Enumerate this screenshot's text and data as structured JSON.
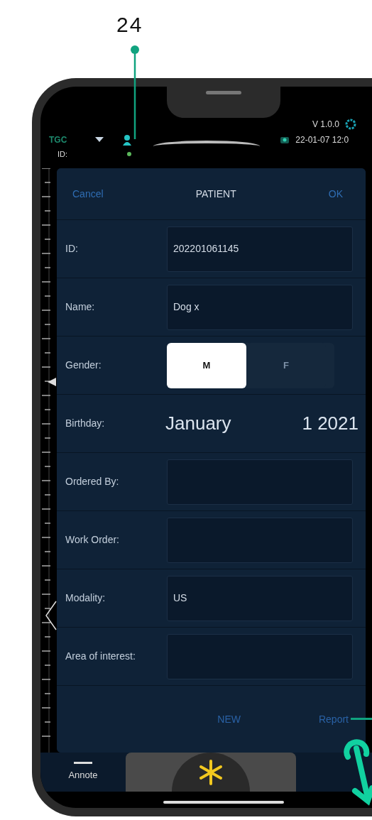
{
  "callout": {
    "number": "24"
  },
  "status_bar": {
    "mode": "TGC",
    "version": "V 1.0.0",
    "datetime": "22-01-07 12:0",
    "id_label": "ID:"
  },
  "dialog": {
    "cancel": "Cancel",
    "title": "PATIENT",
    "ok": "OK",
    "fields": [
      {
        "kind": "input",
        "label": "ID:",
        "value": "202201061145"
      },
      {
        "kind": "input",
        "label": "Name:",
        "value": "Dog x"
      },
      {
        "kind": "toggle",
        "label": "Gender:",
        "options": [
          {
            "label": "M",
            "selected": true
          },
          {
            "label": "F",
            "selected": false
          }
        ]
      },
      {
        "kind": "date",
        "label": "Birthday:",
        "month": "January",
        "day_year": "1 2021"
      },
      {
        "kind": "input",
        "label": "Ordered By:"
      },
      {
        "kind": "input",
        "label": "Work Order:"
      },
      {
        "kind": "input",
        "label": "Modality:",
        "value": "US"
      },
      {
        "kind": "input",
        "label": "Area of interest:"
      }
    ],
    "actions": [
      "NEW",
      "Report"
    ]
  },
  "toolbar": {
    "label": "Annote"
  }
}
